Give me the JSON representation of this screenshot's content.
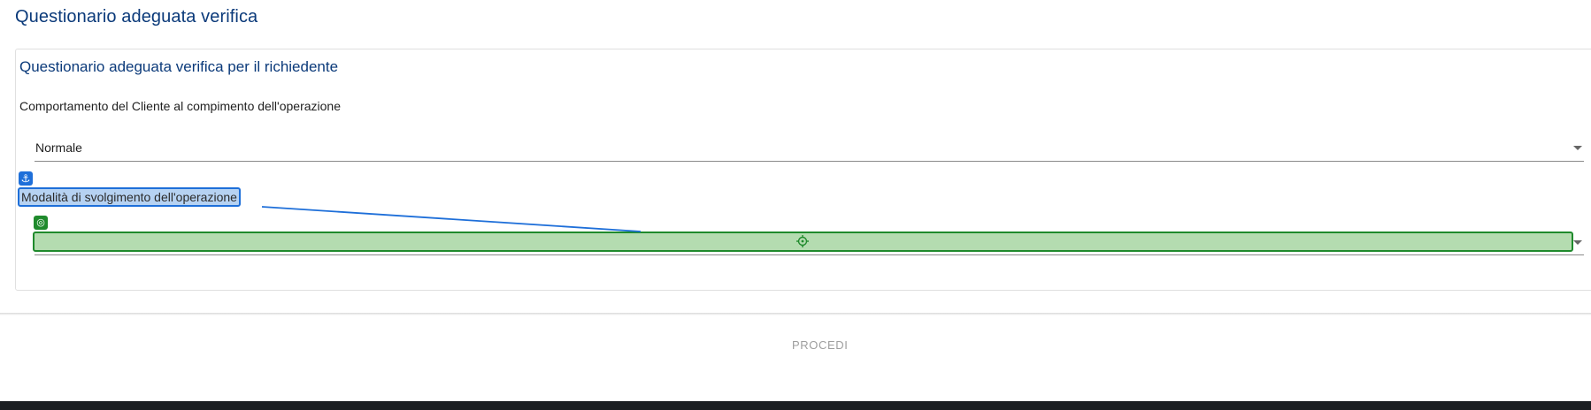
{
  "page": {
    "title": "Questionario adeguata verifica"
  },
  "card": {
    "title": "Questionario adeguata verifica per il richiedente",
    "questions": [
      {
        "label": "Comportamento del Cliente al compimento dell'operazione",
        "selected_value": "Normale"
      },
      {
        "label": "Modalità di svolgimento dell'operazione",
        "selected_value": ""
      }
    ]
  },
  "actions": {
    "procedi_label": "PROCEDI"
  },
  "overlay": {
    "anchor_icon": "anchor-icon",
    "target_icon": "target-icon",
    "crosshair_icon": "crosshair-icon",
    "anchor_color": "#1e6fd9",
    "target_color": "#1f8a2c"
  }
}
